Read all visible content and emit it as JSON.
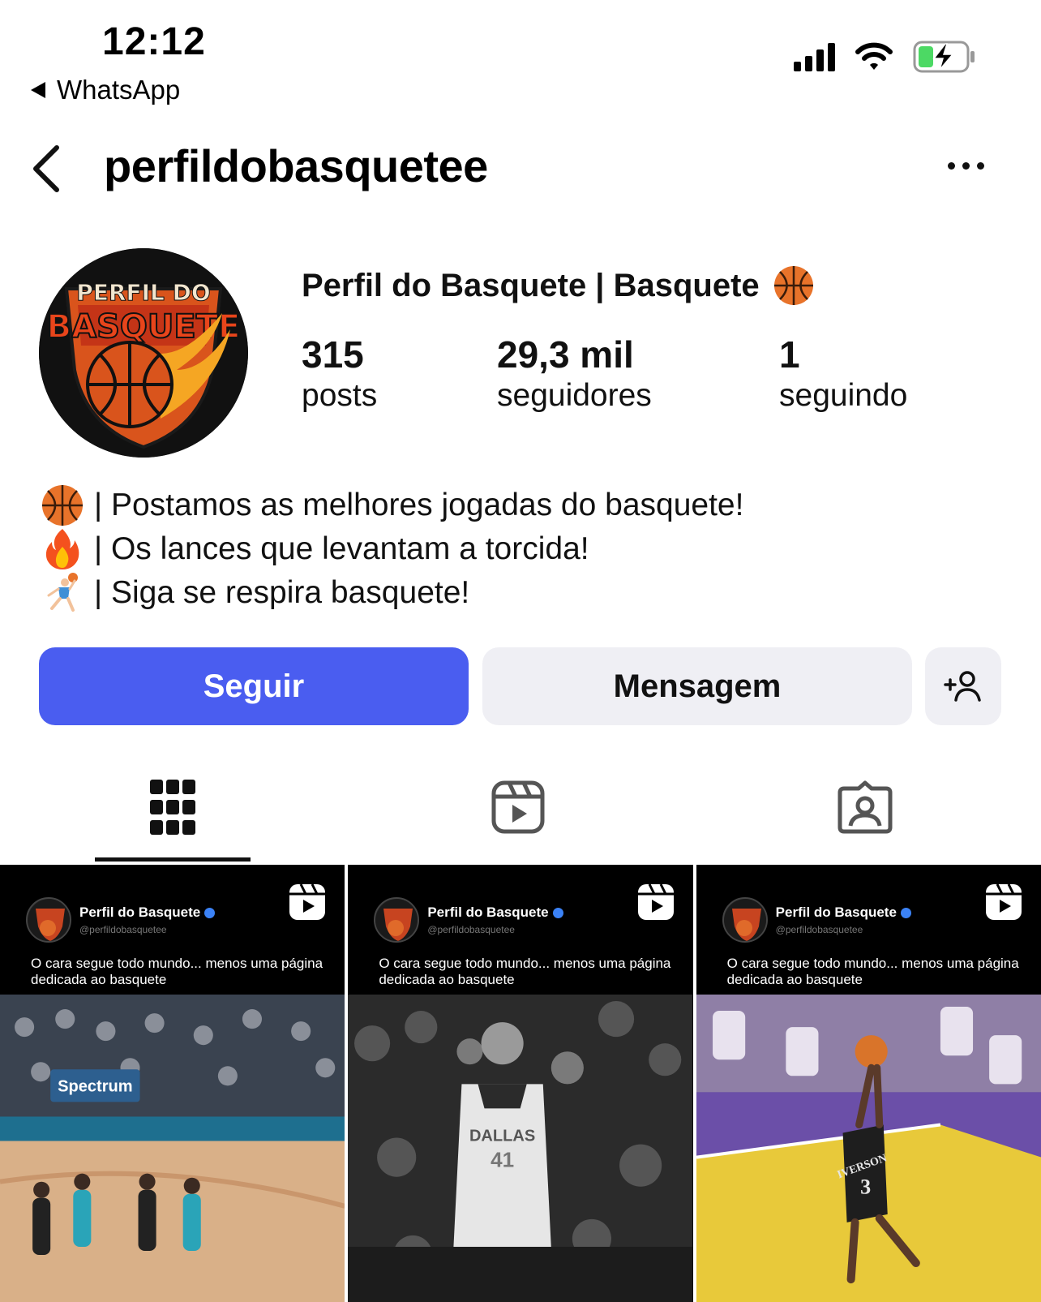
{
  "status_bar": {
    "time": "12:12",
    "back_app": "WhatsApp",
    "icons": [
      "signal-icon",
      "wifi-icon",
      "battery-charging-icon"
    ]
  },
  "header": {
    "username": "perfildobasquetee",
    "back_icon": "chevron-left-icon",
    "more_icon": "more-horizontal-icon"
  },
  "profile": {
    "avatar_logo_line1": "PERFIL DO",
    "avatar_logo_line2": "BASQUETE",
    "display_name": "Perfil do Basquete | Basquete",
    "display_name_emoji": "basketball-emoji",
    "stats": [
      {
        "value": "315",
        "label": "posts"
      },
      {
        "value": "29,3 mil",
        "label": "seguidores"
      },
      {
        "value": "1",
        "label": "seguindo"
      }
    ],
    "bio": [
      {
        "emoji": "basketball-emoji",
        "text": "| Postamos as melhores jogadas do basquete!"
      },
      {
        "emoji": "fire-emoji",
        "text": "| Os lances que levantam a torcida!"
      },
      {
        "emoji": "basketball-player-emoji",
        "text": "| Siga se respira basquete!"
      }
    ]
  },
  "actions": {
    "follow_label": "Seguir",
    "message_label": "Mensagem",
    "add_user_icon": "add-person-icon"
  },
  "tabs": [
    {
      "icon": "grid-icon",
      "active": true
    },
    {
      "icon": "reels-icon",
      "active": false
    },
    {
      "icon": "tagged-icon",
      "active": false
    }
  ],
  "posts": [
    {
      "author": "Perfil do Basquete",
      "handle": "@perfildobasquetee",
      "caption": "O cara segue todo mundo... menos uma página dedicada ao basquete",
      "sign_text": "Spectrum",
      "type": "reel"
    },
    {
      "author": "Perfil do Basquete",
      "handle": "@perfildobasquetee",
      "caption": "O cara segue todo mundo... menos uma página dedicada ao basquete",
      "jersey_text": "DALLAS",
      "jersey_number": "41",
      "type": "reel"
    },
    {
      "author": "Perfil do Basquete",
      "handle": "@perfildobasquetee",
      "caption": "O cara segue todo mundo... menos uma página dedicada ao basquete",
      "jersey_text": "IVERSON",
      "jersey_number": "3",
      "type": "reel"
    }
  ],
  "colors": {
    "follow_button": "#4a5df0",
    "secondary_button": "#efeff4",
    "text": "#111111",
    "battery_green": "#4cd964"
  }
}
